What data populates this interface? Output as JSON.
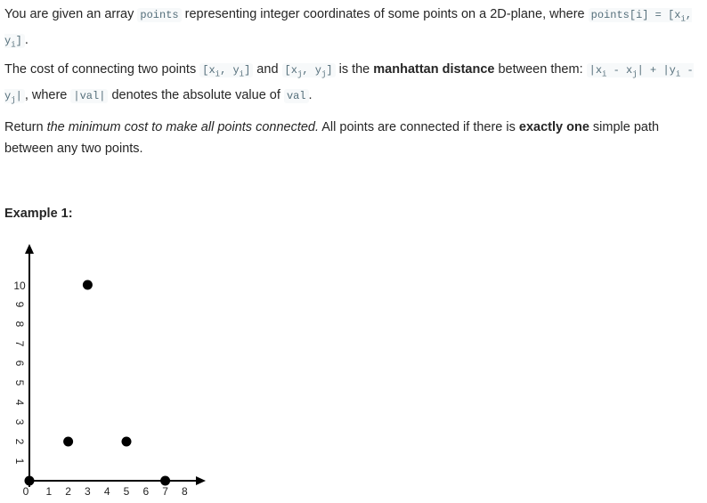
{
  "para1": {
    "t1": "You are given an array ",
    "c1": "points",
    "t2": " representing integer coordinates of some points on a 2D-plane, where ",
    "c2": "points[i] = [x",
    "c2sub1": "i",
    "c2b": ", y",
    "c2sub2": "i",
    "c2c": "]",
    "t3": "."
  },
  "para2": {
    "t1": "The cost of connecting two points ",
    "c1": "[x",
    "c1s1": "i",
    "c1b": ", y",
    "c1s2": "i",
    "c1c": "]",
    "t2": " and ",
    "c2": "[x",
    "c2s1": "j",
    "c2b": ", y",
    "c2s2": "j",
    "c2c": "]",
    "t3": " is the ",
    "b1": "manhattan distance",
    "t4": " between them: ",
    "c3": "|x",
    "c3s1": "i",
    "c3b": " - x",
    "c3s2": "j",
    "c3c": "| + |y",
    "c3s3": "i",
    "c3d": " - y",
    "c3s4": "j",
    "c3e": "|",
    "t5": ", where ",
    "c4": "|val|",
    "t6": " denotes the absolute value of ",
    "c5": "val",
    "t7": "."
  },
  "para3": {
    "t1": "Return ",
    "i1": "the minimum cost to make all points connected.",
    "t2": " All points are connected if there is ",
    "b1": "exactly one",
    "t3": " simple path between any two points."
  },
  "example_title": "Example 1:",
  "chart_data": {
    "type": "scatter",
    "x_ticks": [
      "0",
      "1",
      "2",
      "3",
      "4",
      "5",
      "6",
      "7",
      "8"
    ],
    "y_ticks": [
      "1",
      "2",
      "3",
      "4",
      "5",
      "6",
      "7",
      "8",
      "9",
      "10"
    ],
    "points": [
      [
        0,
        0
      ],
      [
        2,
        2
      ],
      [
        3,
        10
      ],
      [
        5,
        2
      ],
      [
        7,
        0
      ]
    ],
    "xlim": [
      0,
      8
    ],
    "ylim": [
      0,
      10
    ]
  }
}
